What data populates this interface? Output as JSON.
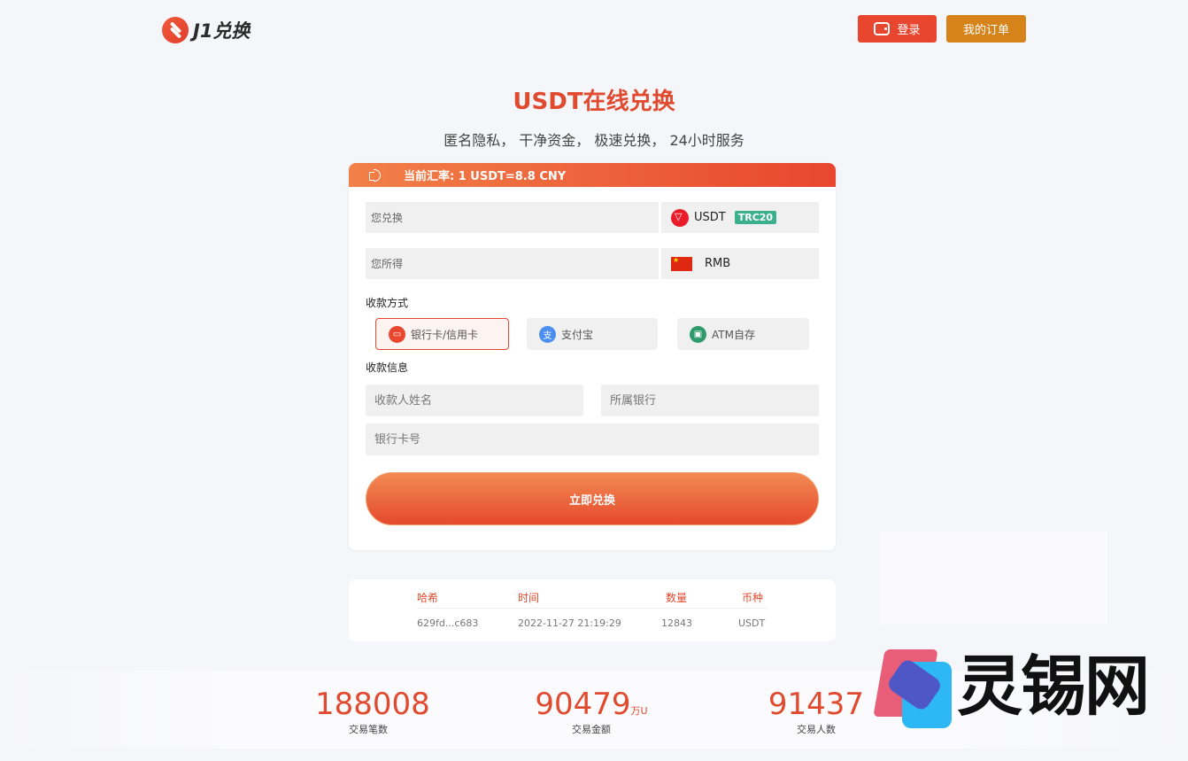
{
  "brand": {
    "name": "J1兑换"
  },
  "header": {
    "login_label": "登录",
    "orders_label": "我的订单"
  },
  "hero": {
    "title": "USDT在线兑换",
    "subtitle": "匿名隐私， 干净资金， 极速兑换， 24小时服务"
  },
  "exchange": {
    "rate_text": "当前汇率: 1 USDT=8.8 CNY",
    "send_label": "您兑换",
    "send_currency": "USDT",
    "send_network": "TRC20",
    "receive_label": "您所得",
    "receive_currency": "RMB",
    "method_title": "收款方式",
    "methods": [
      {
        "label": "银行卡/信用卡",
        "icon": "bank-card-icon",
        "active": true
      },
      {
        "label": "支付宝",
        "icon": "alipay-icon",
        "active": false
      },
      {
        "label": "ATM自存",
        "icon": "atm-icon",
        "active": false
      }
    ],
    "info_title": "收款信息",
    "payee_placeholder": "收款人姓名",
    "bank_placeholder": "所属银行",
    "card_placeholder": "银行卡号",
    "submit_label": "立即兑换"
  },
  "transactions": {
    "headers": [
      "哈希",
      "时间",
      "数量",
      "币种"
    ],
    "rows": [
      [
        "629fd...c683",
        "2022-11-27 21:19:29",
        "12843",
        "USDT"
      ]
    ]
  },
  "stats": [
    {
      "value": "188008",
      "unit": "",
      "label": "交易笔数"
    },
    {
      "value": "90479",
      "unit": "万U",
      "label": "交易金额"
    },
    {
      "value": "91437",
      "unit": "",
      "label": "交易人数"
    }
  ],
  "watermark": {
    "text": "灵锡网"
  },
  "colors": {
    "accent": "#e8462f",
    "orders": "#d6831a",
    "trc": "#3bb08a"
  }
}
